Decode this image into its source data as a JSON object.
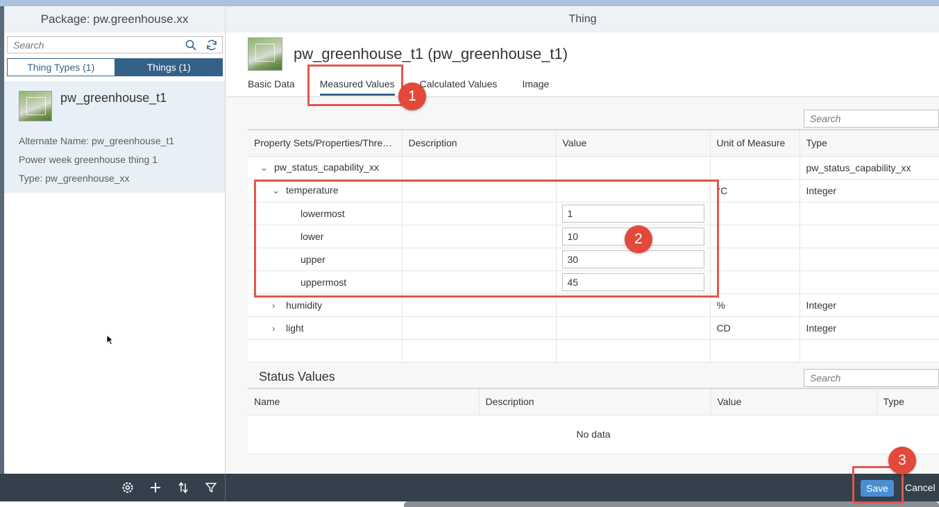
{
  "left_pane": {
    "title": "Package: pw.greenhouse.xx",
    "search_placeholder": "Search",
    "segments": [
      "Thing Types (1)",
      "Things (1)"
    ],
    "item": {
      "title": "pw_greenhouse_t1",
      "alternate_name": "Alternate Name: pw_greenhouse_t1",
      "description": "Power week greenhouse thing 1",
      "type": "Type: pw_greenhouse_xx"
    }
  },
  "right_pane": {
    "title": "Thing",
    "object_title": "pw_greenhouse_t1 (pw_greenhouse_t1)",
    "tabs": [
      "Basic Data",
      "Measured Values",
      "Calculated Values",
      "Image"
    ],
    "active_tab": "Measured Values",
    "search_placeholder": "Search",
    "measured": {
      "headers": [
        "Property Sets/Properties/Thre…",
        "Description",
        "Value",
        "Unit of Measure",
        "Type"
      ],
      "rows": [
        {
          "name": "pw_status_capability_xx",
          "expanded": true,
          "description": "",
          "value": "",
          "uom": "",
          "type": "pw_status_capability_xx"
        },
        {
          "name": "temperature",
          "expanded": true,
          "description": "",
          "value": "",
          "uom": "°C",
          "type": "Integer"
        },
        {
          "name": "lowermost",
          "description": "",
          "value": "1",
          "uom": "",
          "type": ""
        },
        {
          "name": "lower",
          "description": "",
          "value": "10",
          "uom": "",
          "type": ""
        },
        {
          "name": "upper",
          "description": "",
          "value": "30",
          "uom": "",
          "type": ""
        },
        {
          "name": "uppermost",
          "description": "",
          "value": "45",
          "uom": "",
          "type": ""
        },
        {
          "name": "humidity",
          "expanded": false,
          "description": "",
          "value": "",
          "uom": "%",
          "type": "Integer"
        },
        {
          "name": "light",
          "expanded": false,
          "description": "",
          "value": "",
          "uom": "CD",
          "type": "Integer"
        }
      ]
    },
    "status": {
      "title": "Status Values",
      "search_placeholder": "Search",
      "headers": [
        "Name",
        "Description",
        "Value",
        "Type"
      ],
      "empty_text": "No data"
    }
  },
  "footer": {
    "save_label": "Save",
    "cancel_label": "Cancel"
  },
  "annotations": [
    "1",
    "2",
    "3"
  ],
  "colors": {
    "accent": "#346187",
    "save_button": "#4a8ed2",
    "callout": "#e2493b",
    "footer_bg": "#34404c"
  }
}
